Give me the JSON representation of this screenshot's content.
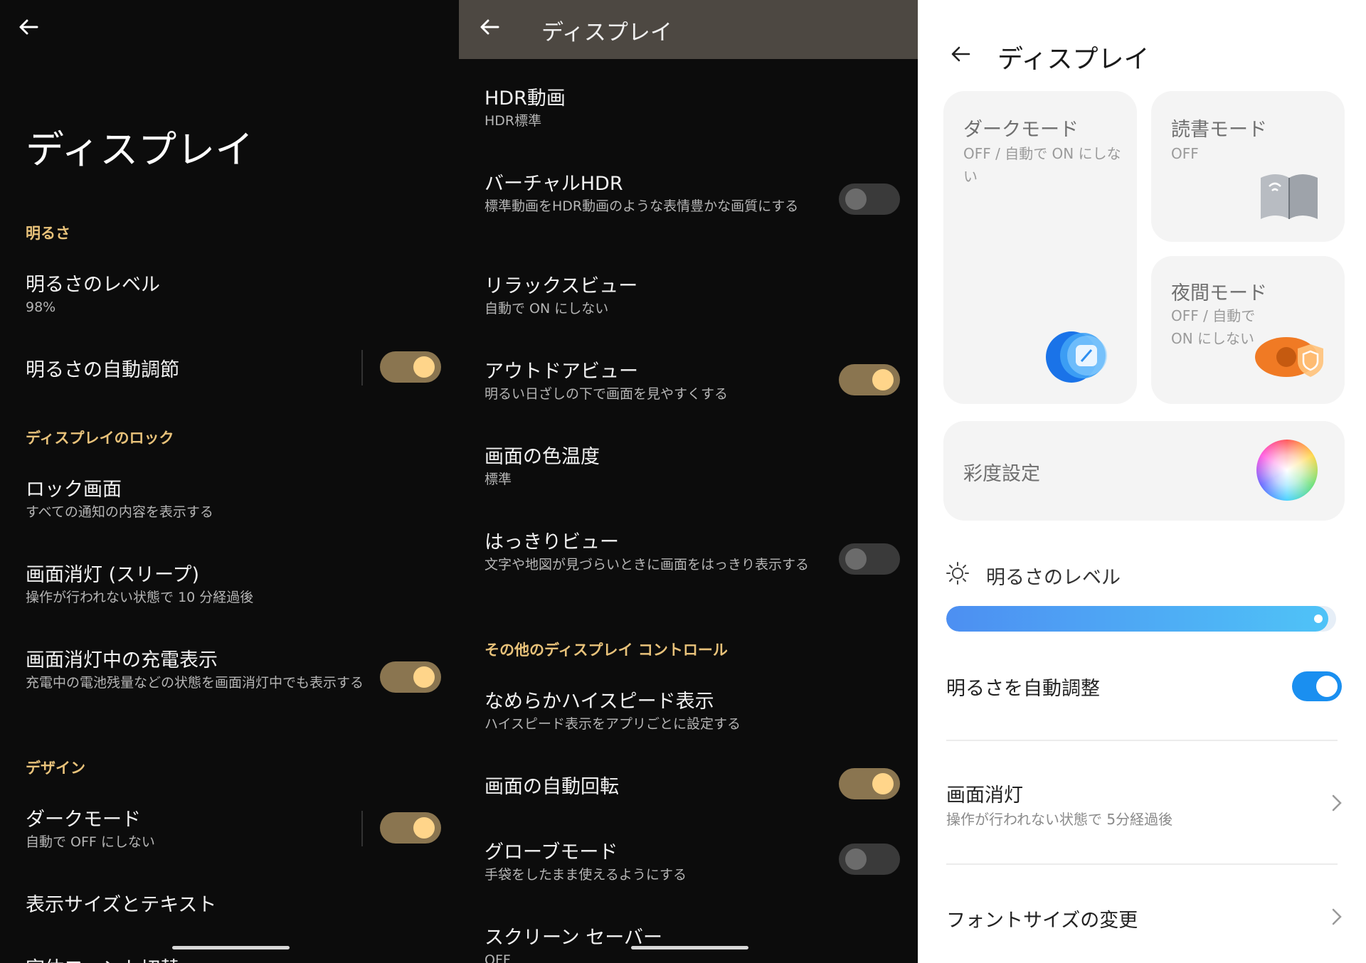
{
  "panel1": {
    "title": "ディスプレイ",
    "sections": {
      "brightness": "明るさ",
      "lock": "ディスプレイのロック",
      "design": "デザイン"
    },
    "items": {
      "brightness_level": {
        "title": "明るさのレベル",
        "sub": "98%"
      },
      "auto_brightness": {
        "title": "明るさの自動調節",
        "on": true
      },
      "lock_screen": {
        "title": "ロック画面",
        "sub": "すべての通知の内容を表示する"
      },
      "sleep": {
        "title": "画面消灯 (スリープ)",
        "sub": "操作が行われない状態で 10 分経過後"
      },
      "charging_display": {
        "title": "画面消灯中の充電表示",
        "sub": "充電中の電池残量などの状態を画面消灯中でも表示する",
        "on": true
      },
      "dark_mode": {
        "title": "ダークモード",
        "sub": "自動で OFF にしない",
        "on": true
      },
      "display_size": {
        "title": "表示サイズとテキスト"
      },
      "font_switch": {
        "title": "字体フォント切替"
      }
    }
  },
  "panel2": {
    "title": "ディスプレイ",
    "section_other": "その他のディスプレイ コントロール",
    "items": {
      "hdr_video": {
        "title": "HDR動画",
        "sub": "HDR標準"
      },
      "virtual_hdr": {
        "title": "バーチャルHDR",
        "sub": "標準動画をHDR動画のような表情豊かな画質にする",
        "on": false
      },
      "relax_view": {
        "title": "リラックスビュー",
        "sub": "自動で ON にしない"
      },
      "outdoor_view": {
        "title": "アウトドアビュー",
        "sub": "明るい日ざしの下で画面を見やすくする",
        "on": true
      },
      "color_temp": {
        "title": "画面の色温度",
        "sub": "標準"
      },
      "clear_view": {
        "title": "はっきりビュー",
        "sub": "文字や地図が見づらいときに画面をはっきり表示する",
        "on": false
      },
      "smooth_high_speed": {
        "title": "なめらかハイスピード表示",
        "sub": "ハイスピード表示をアプリごとに設定する"
      },
      "auto_rotate": {
        "title": "画面の自動回転",
        "on": true
      },
      "glove_mode": {
        "title": "グローブモード",
        "sub": "手袋をしたまま使えるようにする",
        "on": false
      },
      "screensaver": {
        "title": "スクリーン セーバー",
        "sub": "OFF"
      }
    }
  },
  "panel3": {
    "title": "ディスプレイ",
    "cards": {
      "dark_mode": {
        "title": "ダークモード",
        "sub": "OFF / 自動で ON にしない",
        "icon": "dark-mode-icon"
      },
      "reading_mode": {
        "title": "読書モード",
        "sub": "OFF",
        "icon": "book-icon"
      },
      "night_mode": {
        "title": "夜間モード",
        "sub": "OFF / 自動で ON にしない",
        "icon": "eye-shield-icon"
      },
      "saturation": {
        "title": "彩度設定",
        "icon": "color-wheel-icon"
      }
    },
    "brightness": {
      "label": "明るさのレベル",
      "level": 0.98
    },
    "auto_brightness": {
      "label": "明るさを自動調整",
      "on": true
    },
    "screen_off": {
      "title": "画面消灯",
      "sub": "操作が行われない状態で 5分経過後"
    },
    "font_size": {
      "title": "フォントサイズの変更"
    },
    "colors": {
      "accent": "#1a8ff0",
      "dark_accent": "#e8c27a"
    }
  }
}
